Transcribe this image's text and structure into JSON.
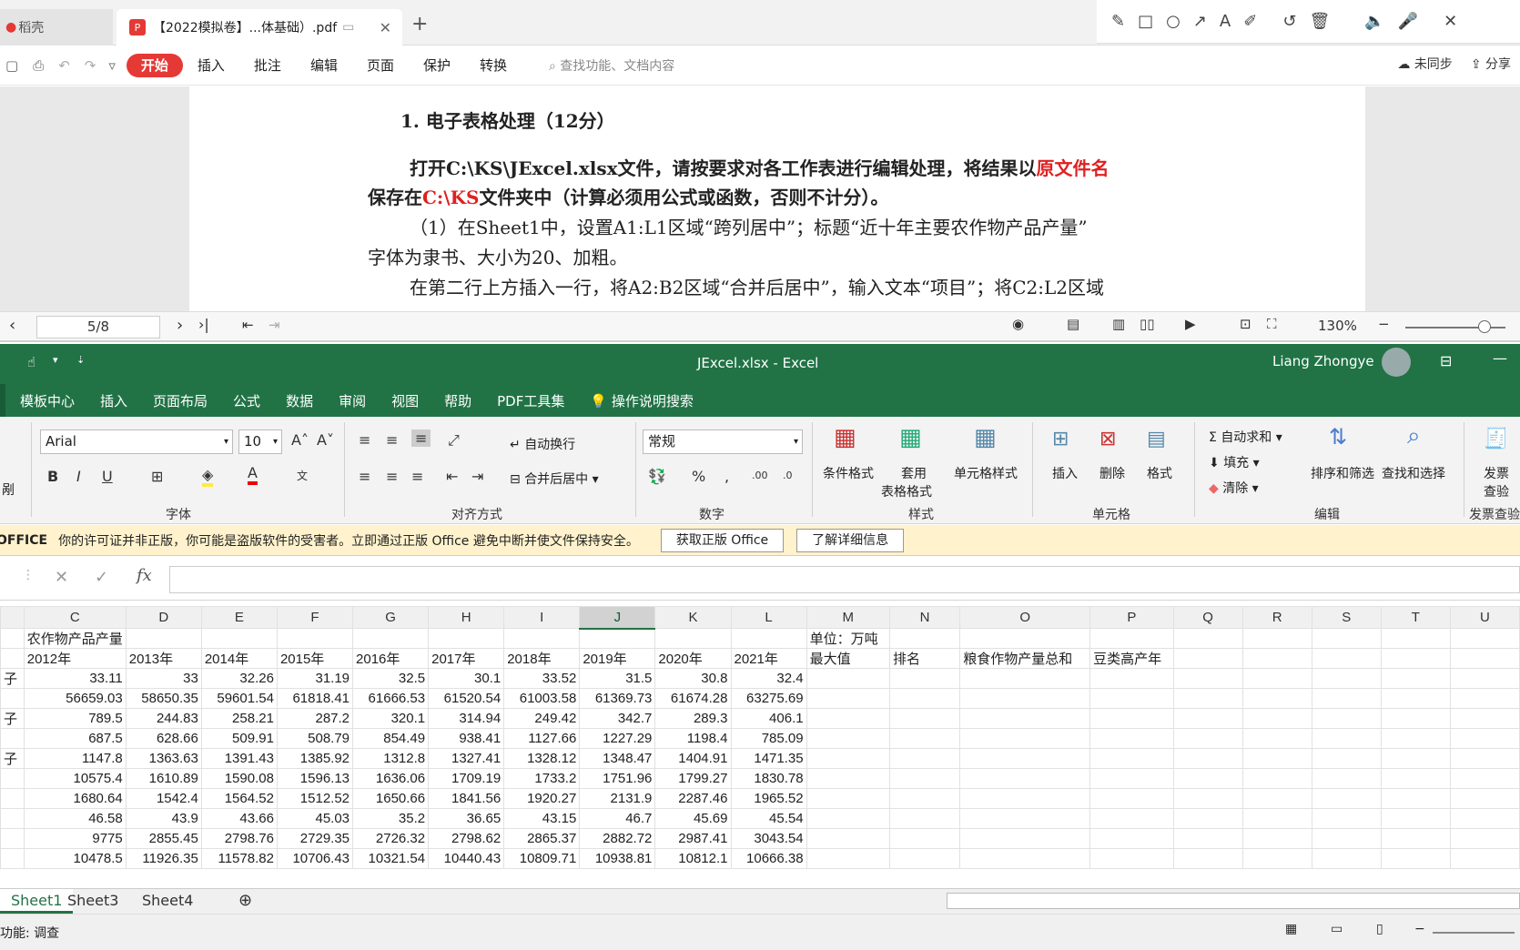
{
  "wps": {
    "tabs": [
      {
        "label": "稻壳"
      },
      {
        "label": "【2022模拟卷】...体基础）.pdf"
      }
    ],
    "menu": [
      "开始",
      "插入",
      "批注",
      "编辑",
      "页面",
      "保护",
      "转换"
    ],
    "search_placeholder": "查找功能、文档内容",
    "sync_label": "未同步",
    "share_label": "分享"
  },
  "document": {
    "heading": "1. 电子表格处理（12分）",
    "p1_a": "打开C:\\KS\\JExcel.xlsx文件，请按要求对各工作表进行编辑处理，将结果以",
    "p1_red": "原文件名",
    "p2_a": "保存在",
    "p2_red": "C:\\KS",
    "p2_b": "文件夹中（计算必须用公式或函数，否则不计分）。",
    "p3": "（1）在Sheet1中，设置A1:L1区域“跨列居中”；标题“近十年主要农作物产品产量”",
    "p4": "字体为隶书、大小为20、加粗。",
    "p5": "在第二行上方插入一行，将A2:B2区域“合并后居中”，输入文本“项目”；将C2:L2区域"
  },
  "doc_nav": {
    "page": "5/8",
    "zoom": "130%"
  },
  "excel": {
    "title": "JExcel.xlsx  -  Excel",
    "user": "Liang Zhongye",
    "menu": [
      "模板中心",
      "插入",
      "页面布局",
      "公式",
      "数据",
      "审阅",
      "视图",
      "帮助",
      "PDF工具集"
    ],
    "tell_me": "操作说明搜索",
    "font_name": "Arial",
    "font_size": "10",
    "number_format": "常规",
    "wrap_text": "自动换行",
    "merge_center": "合并后居中",
    "groups": {
      "font": "字体",
      "align": "对齐方式",
      "number": "数字",
      "styles": "样式",
      "cells": "单元格",
      "edit": "编辑",
      "invoice": "发票查验"
    },
    "styles": {
      "cond": "条件格式",
      "table_a": "套用",
      "table_b": "表格格式",
      "cell": "单元格样式"
    },
    "cells": {
      "insert": "插入",
      "delete": "删除",
      "format": "格式"
    },
    "edit": {
      "autosum": "自动求和",
      "fill": "填充",
      "clear": "清除",
      "sort": "排序和筛选",
      "find": "查找和选择"
    },
    "invoice_a": "发票",
    "invoice_b": "查验",
    "clipboard_label": "剐",
    "warning": {
      "brand": "OFFICE",
      "text": "你的许可证并非正版，你可能是盗版软件的受害者。立即通过正版 Office 避免中断并使文件保持安全。",
      "btn1": "获取正版 Office",
      "btn2": "了解详细信息"
    },
    "columns": [
      "C",
      "D",
      "E",
      "F",
      "G",
      "H",
      "I",
      "J",
      "K",
      "L",
      "M",
      "N",
      "O",
      "P",
      "Q",
      "R",
      "S",
      "T",
      "U"
    ],
    "rows": [
      [
        "农作物产品产量",
        "",
        "",
        "",
        "",
        "",
        "",
        "",
        "",
        "",
        "单位：万吨",
        "",
        "",
        "",
        "",
        "",
        "",
        "",
        ""
      ],
      [
        "2012年",
        "2013年",
        "2014年",
        "2015年",
        "2016年",
        "2017年",
        "2018年",
        "2019年",
        "2020年",
        "2021年",
        "最大值",
        "排名",
        "粮食作物产量总和",
        "豆类高产年",
        "",
        "",
        "",
        "",
        ""
      ],
      [
        "33.11",
        "33",
        "32.26",
        "31.19",
        "32.5",
        "30.1",
        "33.52",
        "31.5",
        "30.8",
        "32.4",
        "",
        "",
        "",
        "",
        "",
        "",
        "",
        "",
        ""
      ],
      [
        "56659.03",
        "58650.35",
        "59601.54",
        "61818.41",
        "61666.53",
        "61520.54",
        "61003.58",
        "61369.73",
        "61674.28",
        "63275.69",
        "",
        "",
        "",
        "",
        "",
        "",
        "",
        "",
        ""
      ],
      [
        "789.5",
        "244.83",
        "258.21",
        "287.2",
        "320.1",
        "314.94",
        "249.42",
        "342.7",
        "289.3",
        "406.1",
        "",
        "",
        "",
        "",
        "",
        "",
        "",
        "",
        ""
      ],
      [
        "687.5",
        "628.66",
        "509.91",
        "508.79",
        "854.49",
        "938.41",
        "1127.66",
        "1227.29",
        "1198.4",
        "785.09",
        "",
        "",
        "",
        "",
        "",
        "",
        "",
        "",
        ""
      ],
      [
        "1147.8",
        "1363.63",
        "1391.43",
        "1385.92",
        "1312.8",
        "1327.41",
        "1328.12",
        "1348.47",
        "1404.91",
        "1471.35",
        "",
        "",
        "",
        "",
        "",
        "",
        "",
        "",
        ""
      ],
      [
        "10575.4",
        "1610.89",
        "1590.08",
        "1596.13",
        "1636.06",
        "1709.19",
        "1733.2",
        "1751.96",
        "1799.27",
        "1830.78",
        "",
        "",
        "",
        "",
        "",
        "",
        "",
        "",
        ""
      ],
      [
        "1680.64",
        "1542.4",
        "1564.52",
        "1512.52",
        "1650.66",
        "1841.56",
        "1920.27",
        "2131.9",
        "2287.46",
        "1965.52",
        "",
        "",
        "",
        "",
        "",
        "",
        "",
        "",
        ""
      ],
      [
        "46.58",
        "43.9",
        "43.66",
        "45.03",
        "35.2",
        "36.65",
        "43.15",
        "46.7",
        "45.69",
        "45.54",
        "",
        "",
        "",
        "",
        "",
        "",
        "",
        "",
        ""
      ],
      [
        "9775",
        "2855.45",
        "2798.76",
        "2729.35",
        "2726.32",
        "2798.62",
        "2865.37",
        "2882.72",
        "2987.41",
        "3043.54",
        "",
        "",
        "",
        "",
        "",
        "",
        "",
        "",
        ""
      ],
      [
        "10478.5",
        "11926.35",
        "11578.82",
        "10706.43",
        "10321.54",
        "10440.43",
        "10809.71",
        "10938.81",
        "10812.1",
        "10666.38",
        "",
        "",
        "",
        "",
        "",
        "",
        "",
        "",
        ""
      ]
    ],
    "row_prefix": [
      "",
      "",
      "子",
      "",
      "子",
      "",
      "子",
      "",
      "",
      "",
      "",
      ""
    ],
    "sheets": [
      "Sheet1",
      "Sheet3",
      "Sheet4"
    ],
    "status": "功能: 调查"
  }
}
